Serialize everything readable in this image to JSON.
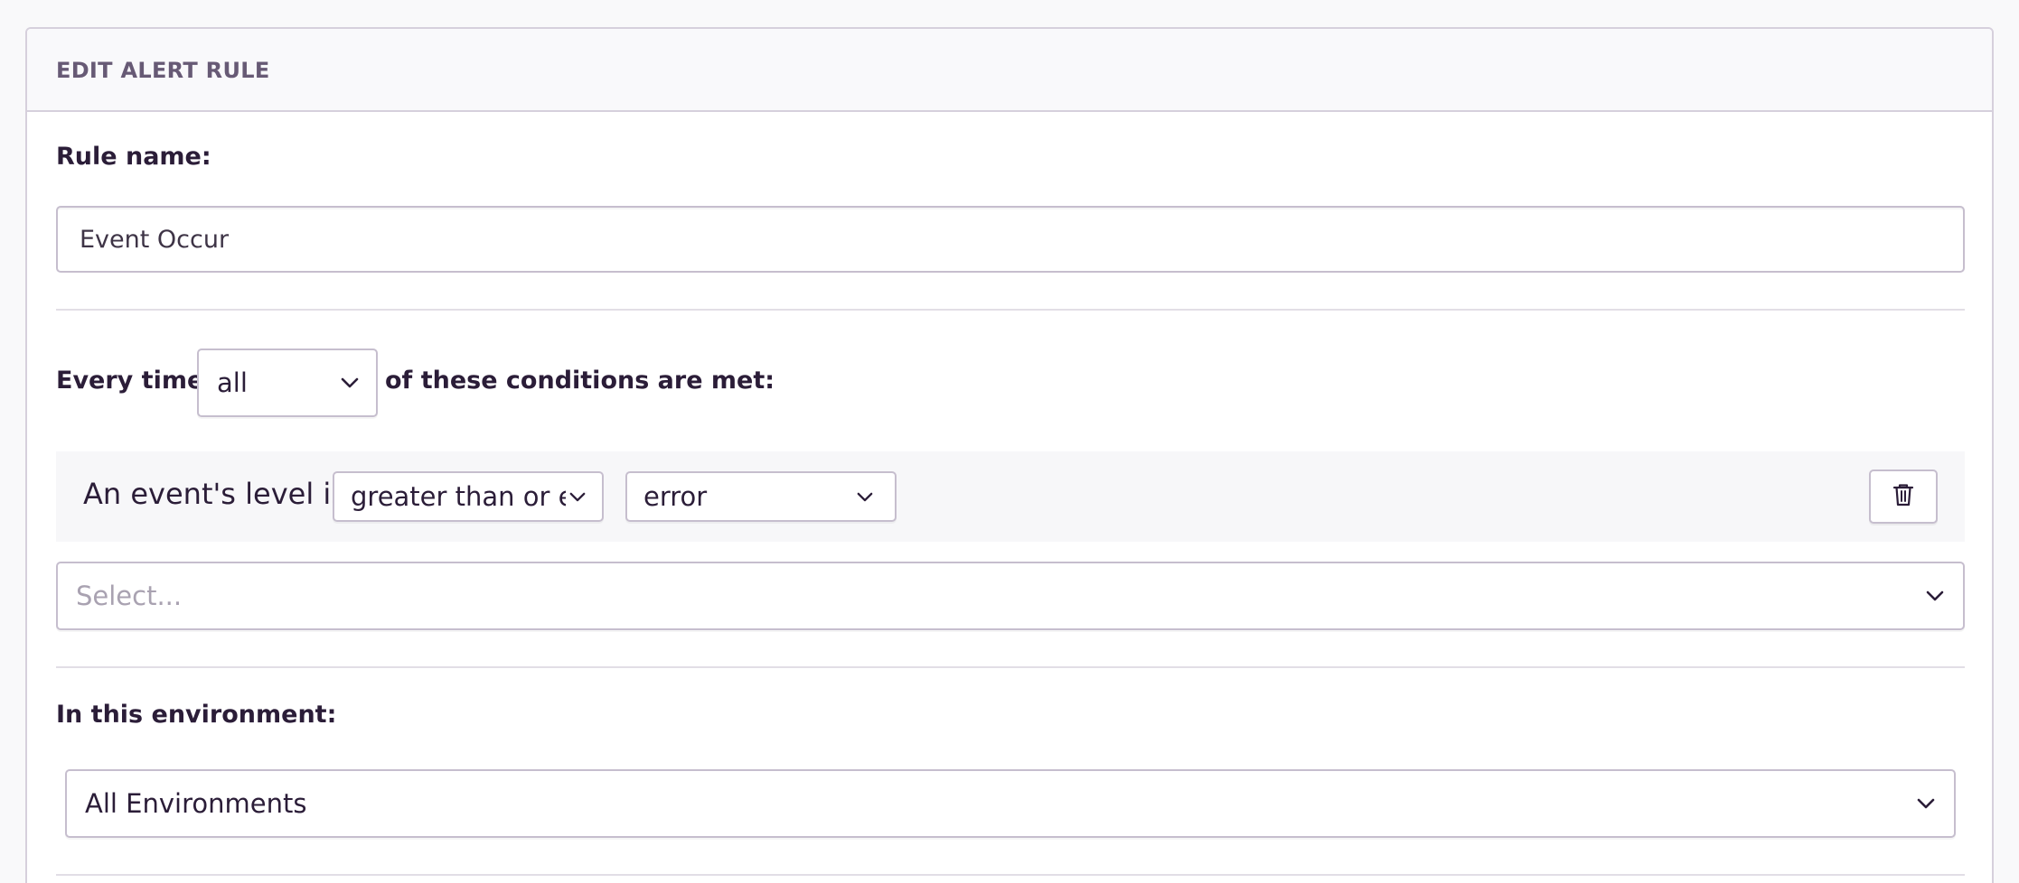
{
  "panel": {
    "title": "EDIT ALERT RULE"
  },
  "rule_name": {
    "label": "Rule name:",
    "value": "Event Occur"
  },
  "conditions": {
    "prefix": "Every time",
    "match_select": {
      "value": "all"
    },
    "suffix": "of these conditions are met:",
    "items": [
      {
        "text": "An event's level is",
        "operator_select": {
          "value": "greater than or equal to"
        },
        "level_select": {
          "value": "error"
        },
        "delete_icon": "trash-icon"
      }
    ],
    "add_select": {
      "placeholder": "Select..."
    }
  },
  "environment": {
    "label": "In this environment:",
    "select": {
      "value": "All Environments"
    }
  },
  "icons": {
    "chevron": "chevron-down-icon",
    "delete": "trash-icon"
  },
  "colors": {
    "text": "#2b1d38",
    "muted": "#675a75",
    "border": "#c6bece",
    "placeholder": "#a9a2b1",
    "header_bg": "#f9f9fb"
  }
}
